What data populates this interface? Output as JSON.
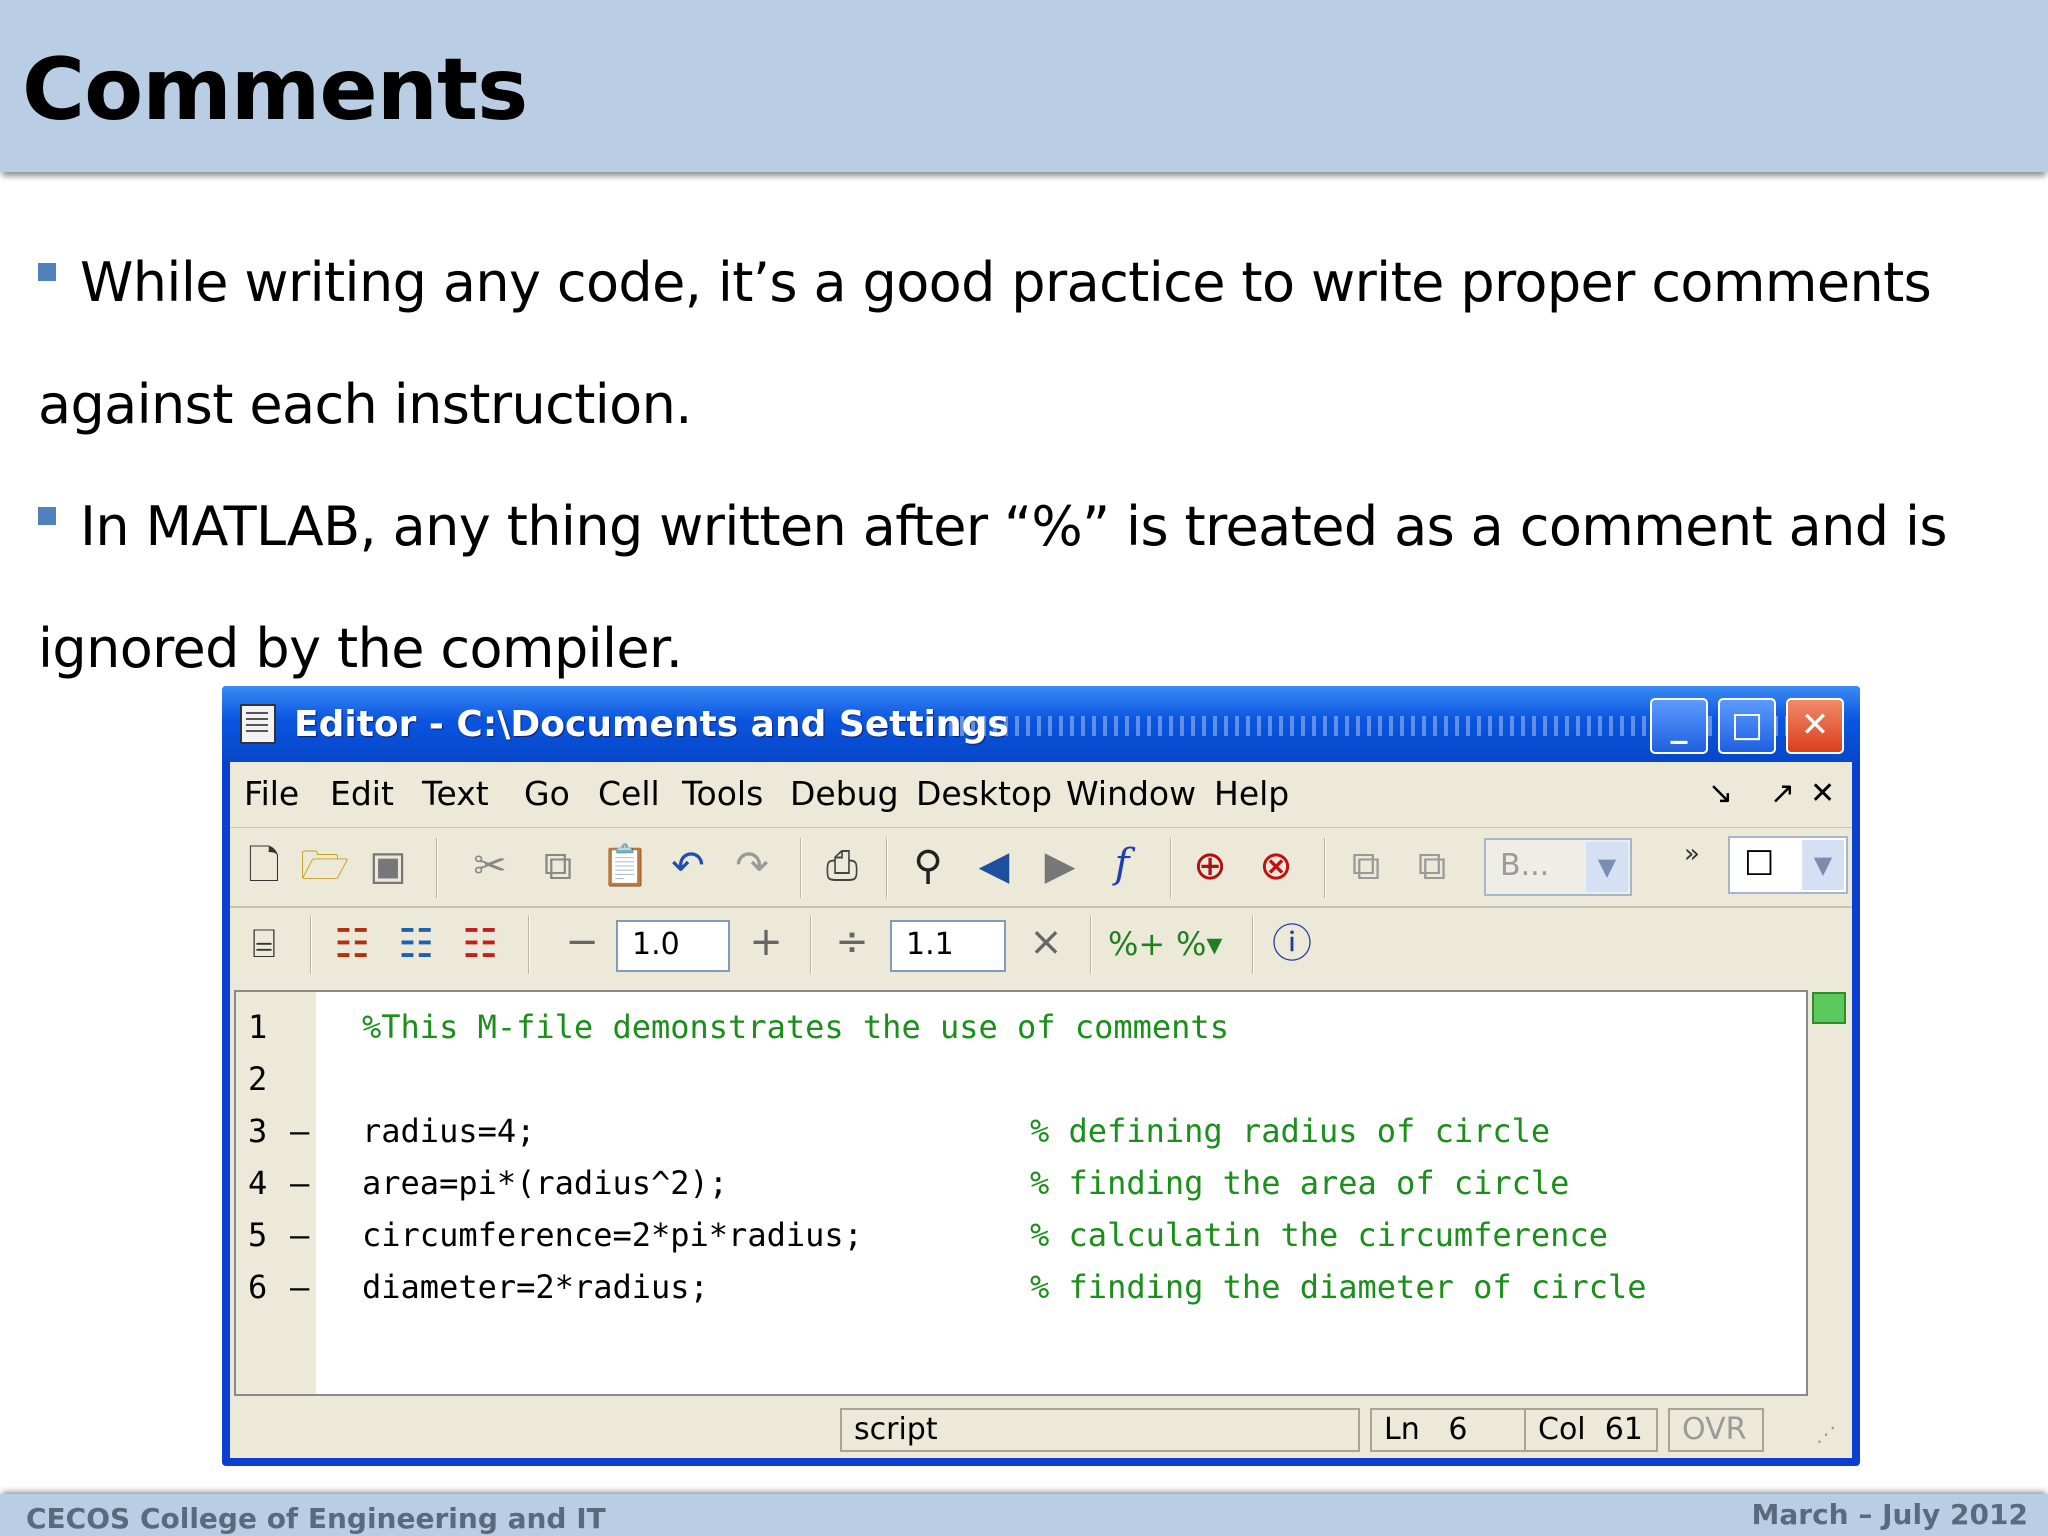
{
  "slide": {
    "title": "Comments",
    "bullets": [
      {
        "line1": "While writing any code, it’s a good practice to write proper comments",
        "line2": "against each instruction."
      },
      {
        "line1": "In MATLAB, any thing written after “%” is treated as a comment and is",
        "line2": "ignored by the compiler."
      }
    ],
    "footer": {
      "left": "CECOS College of Engineering and IT",
      "right": "March – July 2012"
    }
  },
  "editor": {
    "window_title": "Editor - C:\\Documents and Settings",
    "window_buttons": {
      "minimize": "_",
      "maximize": "□",
      "close": "✕"
    },
    "menu": [
      "File",
      "Edit",
      "Text",
      "Go",
      "Cell",
      "Tools",
      "Debug",
      "Desktop",
      "Window",
      "Help"
    ],
    "toolbar": {
      "stack_combo": "B...",
      "chevron": "»",
      "decrement": "−",
      "cell_step_1": "1.0",
      "increment": "+",
      "divide": "÷",
      "cell_step_2": "1.1",
      "multiply": "×"
    },
    "code_lines": [
      {
        "n": "1",
        "dash": "",
        "code": "%This M-file demonstrates the use of comments",
        "comment": "",
        "is_comment_line": true
      },
      {
        "n": "2",
        "dash": "",
        "code": "",
        "comment": "",
        "is_comment_line": false
      },
      {
        "n": "3",
        "dash": "—",
        "code": "radius=4;",
        "comment": "% defining radius of circle",
        "is_comment_line": false
      },
      {
        "n": "4",
        "dash": "—",
        "code": "area=pi*(radius^2);",
        "comment": "% finding the area of circle",
        "is_comment_line": false
      },
      {
        "n": "5",
        "dash": "—",
        "code": "circumference=2*pi*radius;",
        "comment": "% calculatin the circumference",
        "is_comment_line": false
      },
      {
        "n": "6",
        "dash": "—",
        "code": "diameter=2*radius;",
        "comment": "% finding the diameter of circle",
        "is_comment_line": false
      }
    ],
    "status": {
      "mode": "script",
      "ln_label": "Ln",
      "ln_value": "6",
      "col_label": "Col",
      "col_value": "61",
      "ovr": "OVR"
    }
  },
  "colors": {
    "title_band": "#b9cde5",
    "bullet_mark": "#4f81bd",
    "comment_green": "#1a8f1a",
    "xp_titlebar": "#0a55e0",
    "xp_chrome": "#ece9d8"
  },
  "icons": [
    "new-file-icon",
    "open-folder-icon",
    "save-icon",
    "cut-icon",
    "copy-icon",
    "paste-icon",
    "undo-icon",
    "redo-icon",
    "print-icon",
    "find-icon",
    "back-arrow-icon",
    "forward-arrow-icon",
    "function-icon",
    "set-breakpoint-icon",
    "clear-breakpoint-icon",
    "step-icon",
    "step-in-icon",
    "cell-icon",
    "insert-cell-icon",
    "eval-cell-icon",
    "eval-cell-advance-icon",
    "comment-add-icon",
    "comment-remove-icon",
    "info-icon"
  ]
}
